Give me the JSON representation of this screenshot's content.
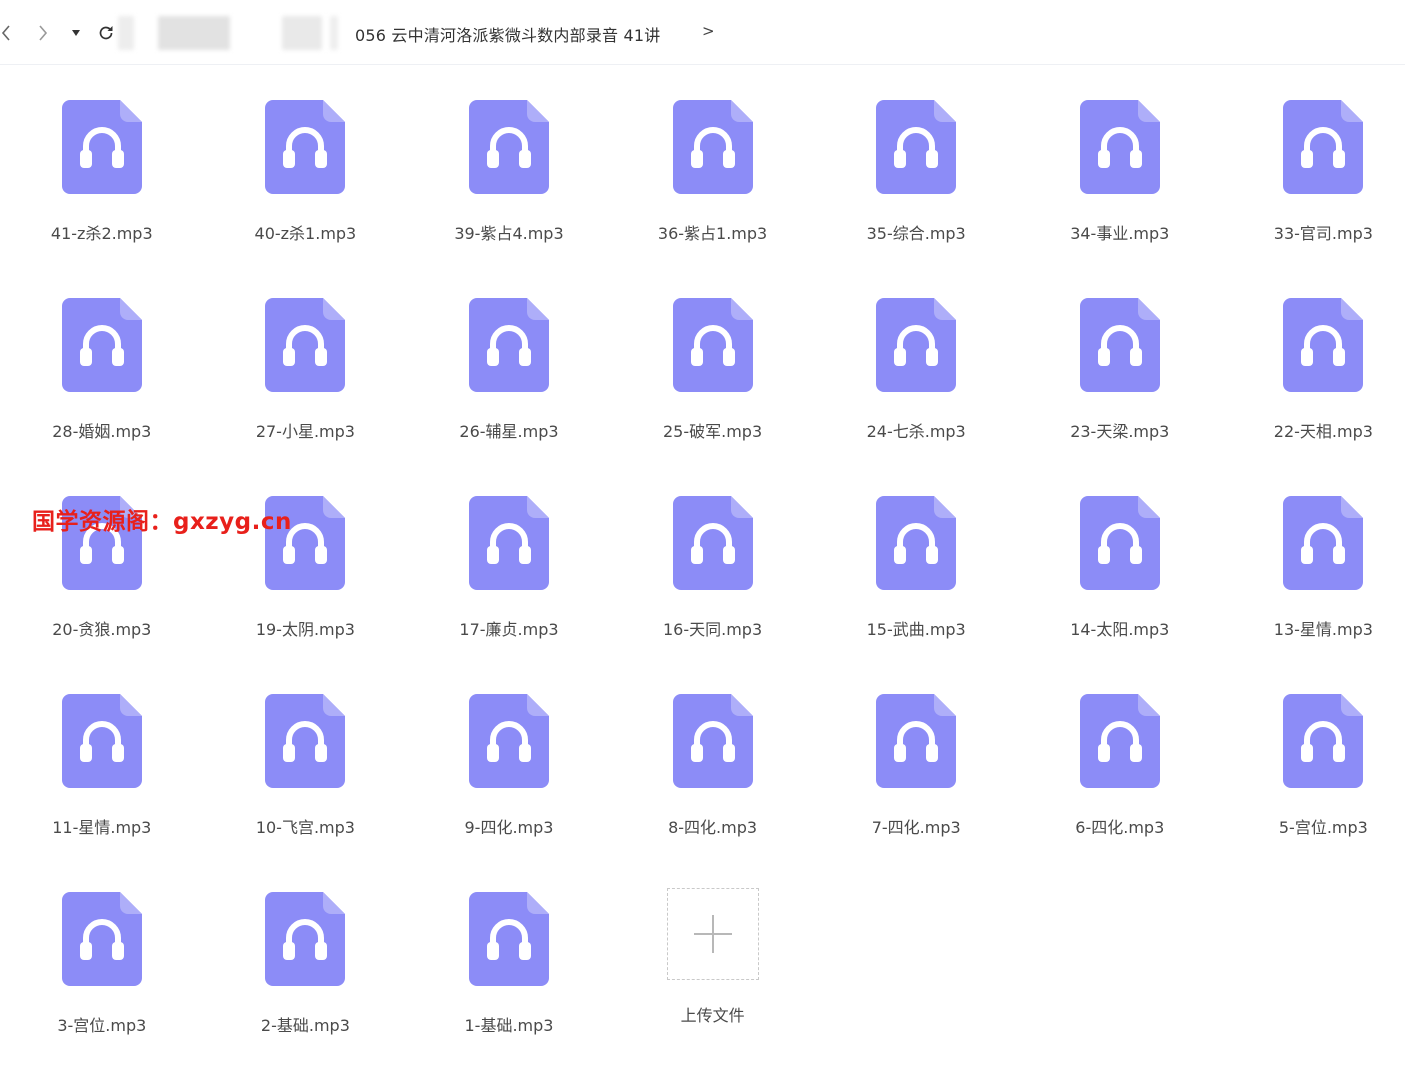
{
  "navigation": {
    "breadcrumb_current": "056 云中清河洛派紫微斗数内部录音 41讲",
    "breadcrumb_more": ">"
  },
  "colors": {
    "icon_fill": "#8c8cf7",
    "icon_fold": "#aeaef9",
    "watermark": "#e8201b"
  },
  "files": [
    {
      "name": "41-z杀2.mp3",
      "icon": "headphones-icon"
    },
    {
      "name": "40-z杀1.mp3",
      "icon": "headphones-icon"
    },
    {
      "name": "39-紫占4.mp3",
      "icon": "headphones-icon"
    },
    {
      "name": "36-紫占1.mp3",
      "icon": "headphones-icon"
    },
    {
      "name": "35-综合.mp3",
      "icon": "headphones-icon"
    },
    {
      "name": "34-事业.mp3",
      "icon": "headphones-icon"
    },
    {
      "name": "33-官司.mp3",
      "icon": "headphones-icon"
    },
    {
      "name": "28-婚姻.mp3",
      "icon": "headphones-icon"
    },
    {
      "name": "27-小星.mp3",
      "icon": "headphones-icon"
    },
    {
      "name": "26-辅星.mp3",
      "icon": "headphones-icon"
    },
    {
      "name": "25-破军.mp3",
      "icon": "headphones-icon"
    },
    {
      "name": "24-七杀.mp3",
      "icon": "headphones-icon"
    },
    {
      "name": "23-天梁.mp3",
      "icon": "headphones-icon"
    },
    {
      "name": "22-天相.mp3",
      "icon": "headphones-icon"
    },
    {
      "name": "20-贪狼.mp3",
      "icon": "headphones-icon"
    },
    {
      "name": "19-太阴.mp3",
      "icon": "headphones-icon"
    },
    {
      "name": "17-廉贞.mp3",
      "icon": "headphones-icon"
    },
    {
      "name": "16-天同.mp3",
      "icon": "headphones-icon"
    },
    {
      "name": "15-武曲.mp3",
      "icon": "headphones-icon"
    },
    {
      "name": "14-太阳.mp3",
      "icon": "headphones-icon"
    },
    {
      "name": "13-星情.mp3",
      "icon": "headphones-icon"
    },
    {
      "name": "11-星情.mp3",
      "icon": "headphones-icon"
    },
    {
      "name": "10-飞宫.mp3",
      "icon": "headphones-icon"
    },
    {
      "name": "9-四化.mp3",
      "icon": "headphones-icon"
    },
    {
      "name": "8-四化.mp3",
      "icon": "headphones-icon"
    },
    {
      "name": "7-四化.mp3",
      "icon": "headphones-icon"
    },
    {
      "name": "6-四化.mp3",
      "icon": "headphones-icon"
    },
    {
      "name": "5-宫位.mp3",
      "icon": "headphones-icon"
    },
    {
      "name": "3-宫位.mp3",
      "icon": "headphones-icon"
    },
    {
      "name": "2-基础.mp3",
      "icon": "headphones-icon"
    },
    {
      "name": "1-基础.mp3",
      "icon": "headphones-icon"
    }
  ],
  "upload": {
    "label": "上传文件",
    "icon": "plus-icon"
  },
  "watermark": {
    "text": "国学资源阁：gxzyg.cn"
  }
}
